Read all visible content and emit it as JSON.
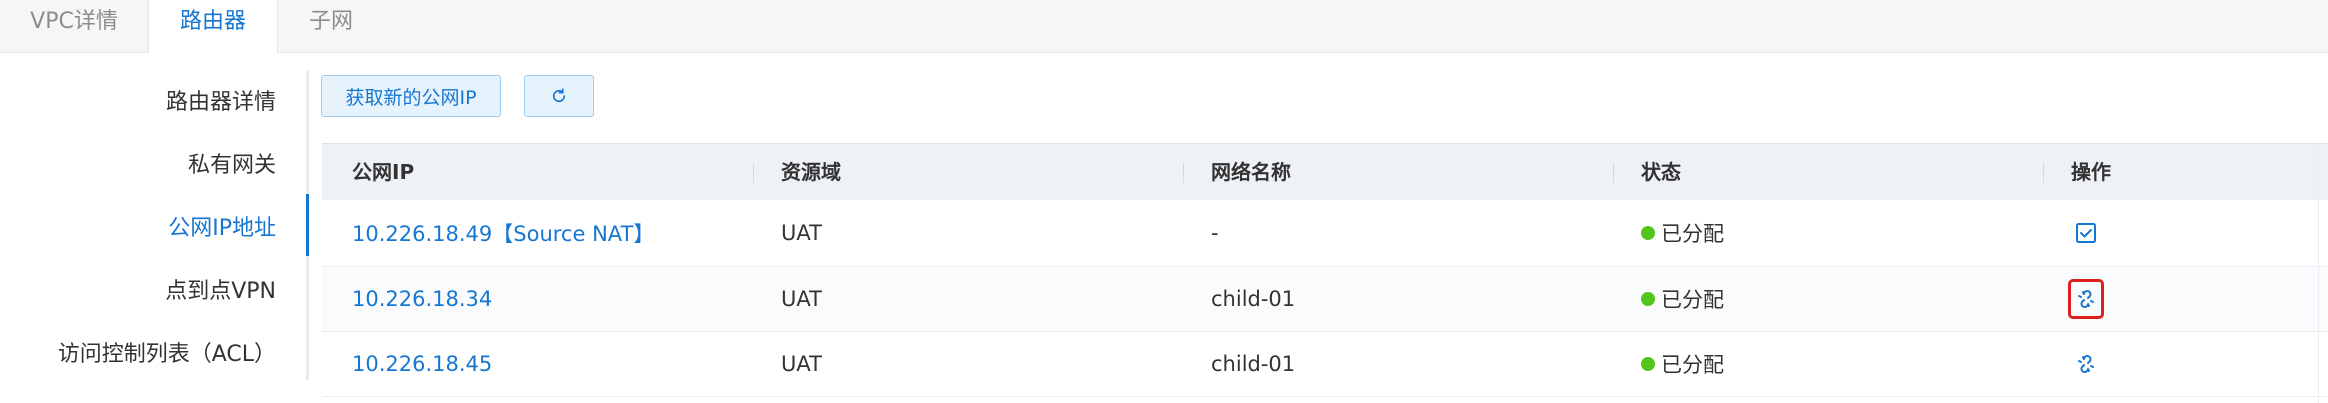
{
  "tabs": [
    "VPC详情",
    "路由器",
    "子网"
  ],
  "active_tab": "路由器",
  "side_menu": [
    "路由器详情",
    "私有网关",
    "公网IP地址",
    "点到点VPN",
    "访问控制列表（ACL）"
  ],
  "active_menu": "公网IP地址",
  "toolbar": {
    "new_ip_label": "获取新的公网IP",
    "refresh_icon": "refresh-icon"
  },
  "table": {
    "headers": [
      "公网IP",
      "资源域",
      "网络名称",
      "状态",
      "操作"
    ],
    "rows": [
      {
        "ip": "10.226.18.49【Source NAT】",
        "domain": "UAT",
        "network": "-",
        "status": "已分配",
        "action_icon": "checkbox-checked-icon"
      },
      {
        "ip": "10.226.18.34",
        "domain": "UAT",
        "network": "child-01",
        "status": "已分配",
        "action_icon": "unlink-icon"
      },
      {
        "ip": "10.226.18.45",
        "domain": "UAT",
        "network": "child-01",
        "status": "已分配",
        "action_icon": "unlink-icon"
      }
    ]
  },
  "colors": {
    "accent": "#1677d2",
    "status_ok": "#52c41a",
    "highlight": "#e02020"
  }
}
